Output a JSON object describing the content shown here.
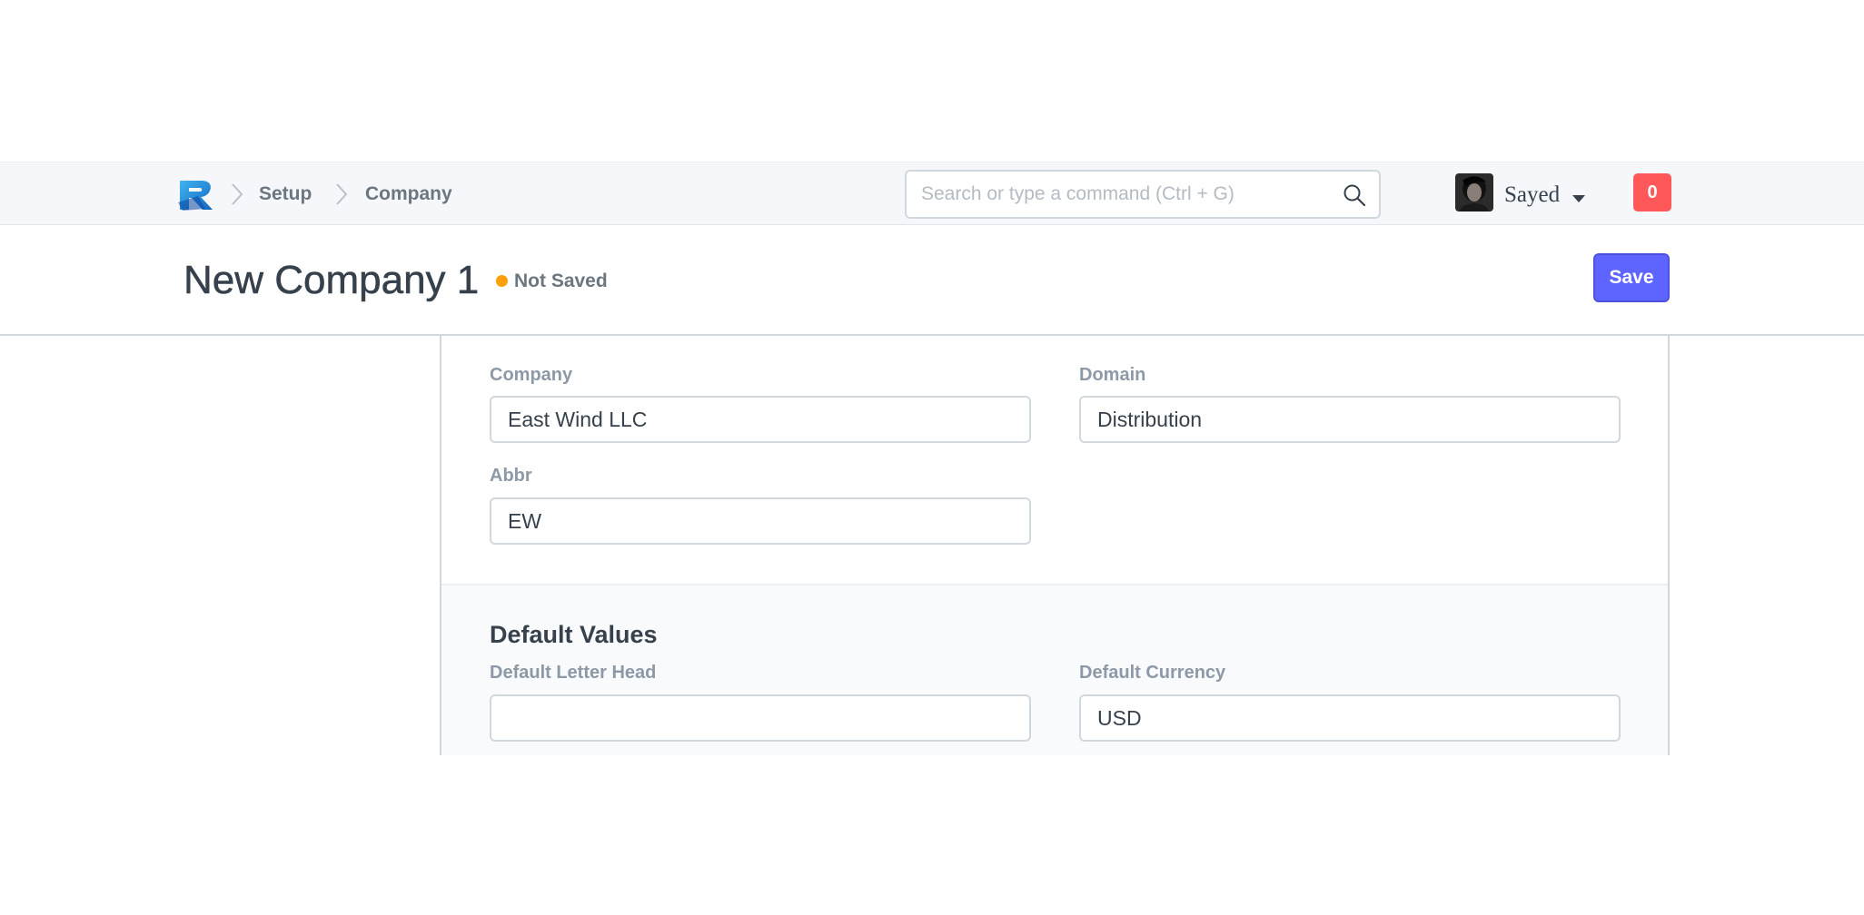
{
  "navbar": {
    "breadcrumbs": [
      "Setup",
      "Company"
    ],
    "search": {
      "placeholder": "Search or type a command (Ctrl + G)",
      "value": ""
    },
    "user": {
      "name": "Sayed"
    },
    "notifications": {
      "count": "0"
    }
  },
  "page": {
    "title": "New Company 1",
    "status": "Not Saved",
    "save_label": "Save"
  },
  "form": {
    "company": {
      "label": "Company",
      "value": "East Wind LLC"
    },
    "domain": {
      "label": "Domain",
      "value": "Distribution"
    },
    "abbr": {
      "label": "Abbr",
      "value": "EW"
    },
    "default_values": {
      "title": "Default Values",
      "letter_head": {
        "label": "Default Letter Head",
        "value": ""
      },
      "currency": {
        "label": "Default Currency",
        "value": "USD"
      }
    }
  },
  "colors": {
    "accent": "#5e64ff",
    "status_dot": "#ffa00a",
    "notification": "#ff5858"
  },
  "icons": [
    "app-logo-icon",
    "chevron-right-icon",
    "search-icon",
    "caret-down-icon"
  ]
}
